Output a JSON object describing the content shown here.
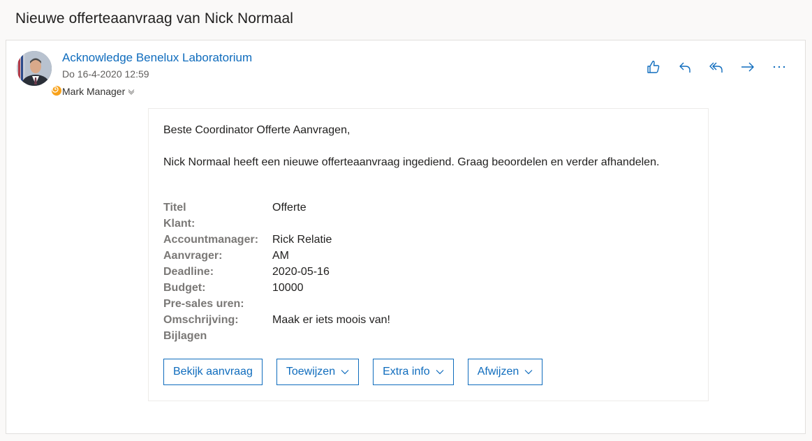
{
  "subject": "Nieuwe offerteaanvraag van Nick Normaal",
  "message": {
    "sender": "Acknowledge Benelux Laboratorium",
    "date": "Do 16-4-2020 12:59",
    "recipient": "Mark Manager",
    "actions": [
      "like-icon",
      "reply-icon",
      "reply-all-icon",
      "forward-icon",
      "more-icon"
    ]
  },
  "body": {
    "greeting": "Beste Coordinator Offerte Aanvragen,",
    "intro": "Nick Normaal heeft een nieuwe offerteaanvraag ingediend. Graag beoordelen en verder afhandelen.",
    "fields": [
      {
        "label": "Titel",
        "value": "Offerte"
      },
      {
        "label": "Klant:",
        "value": ""
      },
      {
        "label": "Accountmanager:",
        "value": "Rick Relatie"
      },
      {
        "label": "Aanvrager:",
        "value": "AM"
      },
      {
        "label": "Deadline:",
        "value": "2020-05-16"
      },
      {
        "label": "Budget:",
        "value": "10000"
      },
      {
        "label": "Pre-sales uren:",
        "value": ""
      },
      {
        "label": "Omschrijving:",
        "value": "Maak er iets moois van!"
      },
      {
        "label": "Bijlagen",
        "value": ""
      }
    ],
    "buttons": {
      "view": "Bekijk aanvraag",
      "assign": "Toewijzen",
      "extra": "Extra info",
      "reject": "Afwijzen"
    }
  },
  "colors": {
    "accent": "#0f6cbd",
    "presence_away": "#f8a21b",
    "label_grey": "#7a7876"
  }
}
